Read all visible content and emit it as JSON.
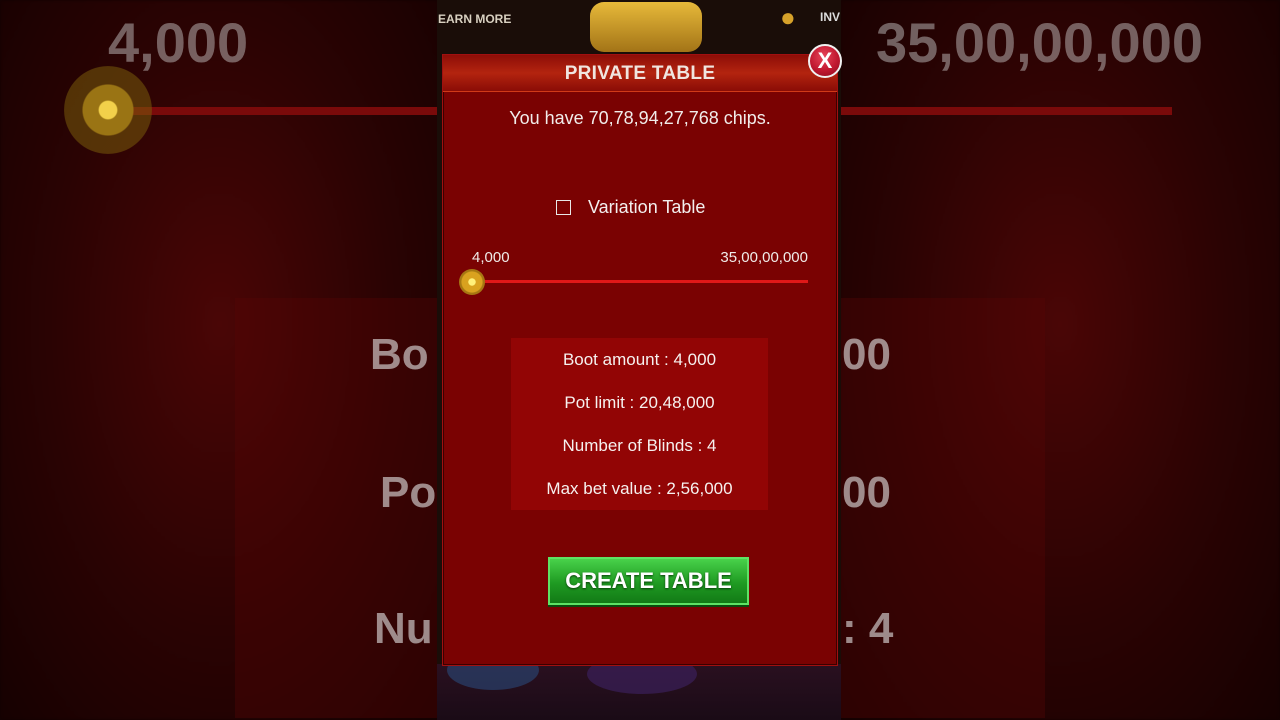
{
  "background": {
    "left_top_value": "4,000",
    "right_top_value": "35,00,00,000",
    "left_mid_1": "Bo",
    "right_mid_1": "00",
    "left_mid_2": "Po",
    "right_mid_2": "00",
    "left_mid_3": "Nu",
    "right_mid_3": ": 4",
    "earn_more": "EARN MORE",
    "invite_label": "INV"
  },
  "dialog": {
    "title": "PRIVATE TABLE",
    "close_label": "X",
    "chips_text": "You have 70,78,94,27,768 chips.",
    "variation_label": "Variation Table",
    "variation_checked": false,
    "slider": {
      "min_label": "4,000",
      "max_label": "35,00,00,000",
      "value_fraction": 0
    },
    "info": {
      "boot_amount": "Boot amount :  4,000",
      "pot_limit": "Pot limit : 20,48,000",
      "blinds": "Number of Blinds : 4",
      "max_bet": "Max bet value : 2,56,000"
    },
    "create_button": "CREATE TABLE"
  },
  "colors": {
    "dialog_bg": "#7a0202",
    "slider_track": "#e01818",
    "create_button": "#1f9a22"
  }
}
